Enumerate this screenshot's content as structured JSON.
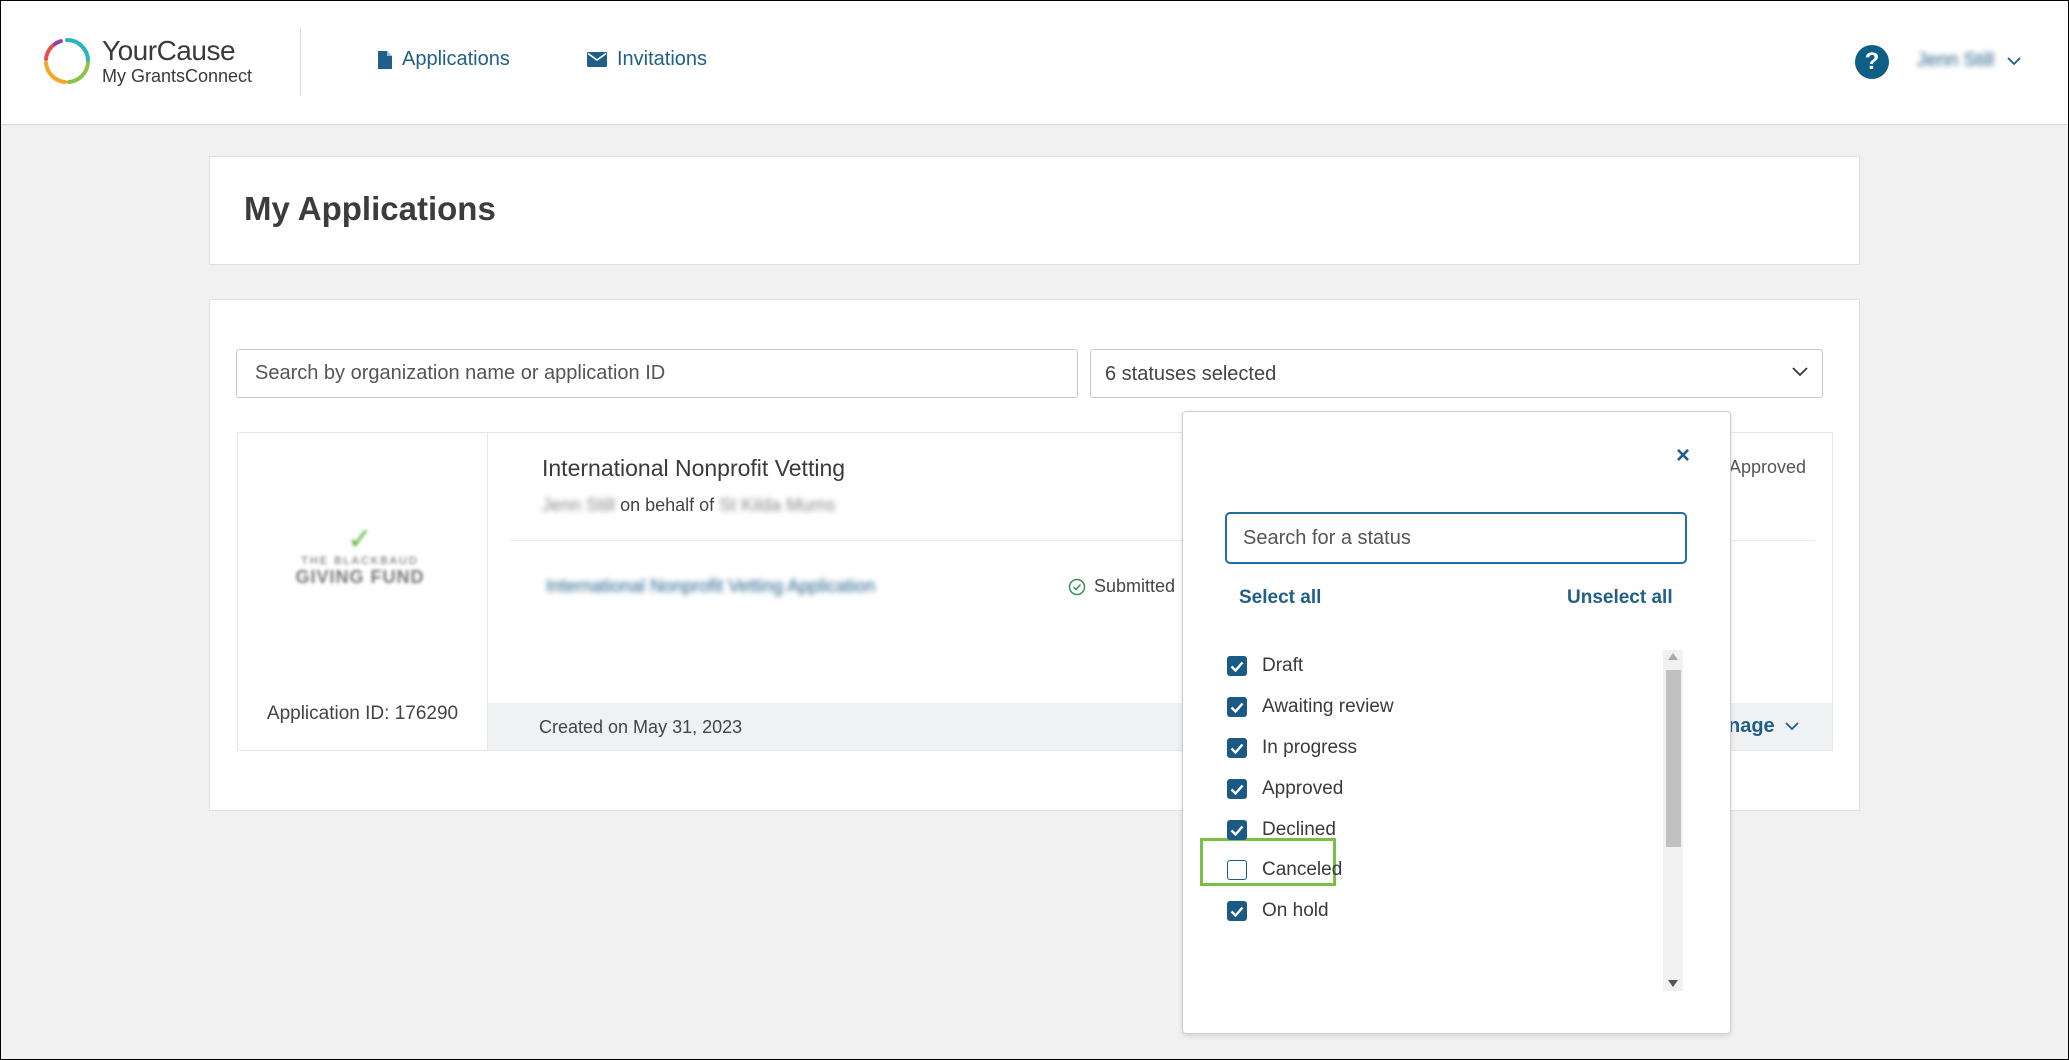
{
  "header": {
    "logo_title": "YourCause",
    "logo_subtitle": "My GrantsConnect",
    "nav": [
      {
        "label": "Applications",
        "icon": "document-icon"
      },
      {
        "label": "Invitations",
        "icon": "envelope-icon"
      }
    ],
    "help_icon_label": "?",
    "user_name": "Jenn Still"
  },
  "page": {
    "title": "My Applications"
  },
  "filters": {
    "search_placeholder": "Search by organization name or application ID",
    "status_summary": "6 statuses selected"
  },
  "application": {
    "program_title": "International Nonprofit Vetting",
    "applicant": "Jenn Still",
    "on_behalf_text": "on behalf of",
    "organization": "St Kilda Mums",
    "status": "Approved",
    "form_link": "International Nonprofit Vetting Application",
    "form_status": "Submitted",
    "application_id": "Application ID: 176290",
    "created": "Created on May 31, 2023",
    "manage_label": "nage",
    "fund_logo_small": "THE BLACKBAUD",
    "fund_logo_big": "GIVING FUND"
  },
  "status_dropdown": {
    "close_label": "×",
    "search_placeholder": "Search for a status",
    "select_all": "Select all",
    "unselect_all": "Unselect all",
    "options": [
      {
        "label": "Draft",
        "checked": true
      },
      {
        "label": "Awaiting review",
        "checked": true
      },
      {
        "label": "In progress",
        "checked": true
      },
      {
        "label": "Approved",
        "checked": true
      },
      {
        "label": "Declined",
        "checked": true
      },
      {
        "label": "Canceled",
        "checked": false
      },
      {
        "label": "On hold",
        "checked": true
      }
    ]
  },
  "colors": {
    "brand_blue": "#1f5f88",
    "checkbox_blue": "#1a5a85",
    "highlight_green": "#78c043"
  }
}
